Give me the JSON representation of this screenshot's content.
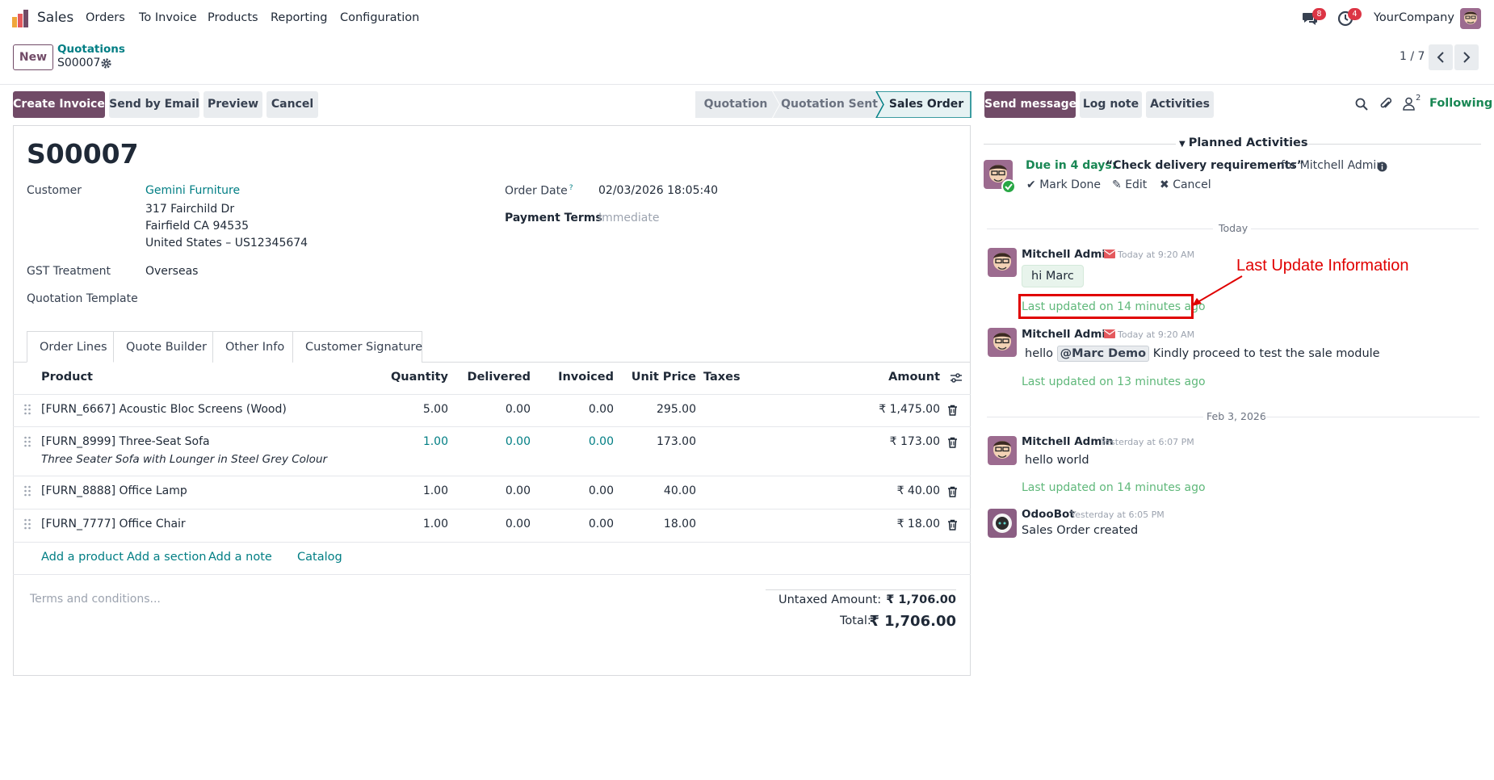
{
  "navbar": {
    "app_name": "Sales",
    "menu": [
      "Orders",
      "To Invoice",
      "Products",
      "Reporting",
      "Configuration"
    ],
    "chat_count": "8",
    "activity_count": "4",
    "company": "YourCompany"
  },
  "control_panel": {
    "new_label": "New",
    "breadcrumb_parent": "Quotations",
    "record_name": "S00007",
    "pager": "1 / 7"
  },
  "actions": {
    "create_invoice": "Create Invoice",
    "send_by_email": "Send by Email",
    "preview": "Preview",
    "cancel": "Cancel"
  },
  "statusbar": {
    "steps": [
      "Quotation",
      "Quotation Sent",
      "Sales Order"
    ],
    "active": "Sales Order"
  },
  "form": {
    "title": "S00007",
    "customer_label": "Customer",
    "customer_name": "Gemini Furniture",
    "customer_address": [
      "317 Fairchild Dr",
      "Fairfield CA 94535",
      "United States – US12345674"
    ],
    "gst_label": "GST Treatment",
    "gst_value": "Overseas",
    "template_label": "Quotation Template",
    "order_date_label": "Order Date",
    "order_date_help": "?",
    "order_date_value": "02/03/2026 18:05:40",
    "payment_terms_label": "Payment Terms",
    "payment_terms_value": "Immediate"
  },
  "tabs": [
    "Order Lines",
    "Quote Builder",
    "Other Info",
    "Customer Signature"
  ],
  "table": {
    "headers": {
      "product": "Product",
      "quantity": "Quantity",
      "delivered": "Delivered",
      "invoiced": "Invoiced",
      "unit_price": "Unit Price",
      "taxes": "Taxes",
      "amount": "Amount"
    },
    "rows": [
      {
        "product": "[FURN_6667] Acoustic Bloc Screens (Wood)",
        "description": "",
        "quantity": "5.00",
        "delivered": "0.00",
        "invoiced": "0.00",
        "unit_price": "295.00",
        "amount": "₹ 1,475.00"
      },
      {
        "product": "[FURN_8999] Three-Seat Sofa",
        "description": "Three Seater Sofa with Lounger in Steel Grey Colour",
        "quantity": "1.00",
        "delivered": "0.00",
        "invoiced": "0.00",
        "unit_price": "173.00",
        "amount": "₹ 173.00"
      },
      {
        "product": "[FURN_8888] Office Lamp",
        "description": "",
        "quantity": "1.00",
        "delivered": "0.00",
        "invoiced": "0.00",
        "unit_price": "40.00",
        "amount": "₹ 40.00"
      },
      {
        "product": "[FURN_7777] Office Chair",
        "description": "",
        "quantity": "1.00",
        "delivered": "0.00",
        "invoiced": "0.00",
        "unit_price": "18.00",
        "amount": "₹ 18.00"
      }
    ],
    "add_links": [
      "Add a product",
      "Add a section",
      "Add a note",
      "Catalog"
    ]
  },
  "totals": {
    "terms_placeholder": "Terms and conditions...",
    "untaxed_label": "Untaxed Amount:",
    "untaxed_value": "₹ 1,706.00",
    "total_label": "Total:",
    "total_value": "₹ 1,706.00"
  },
  "chatter": {
    "send_message": "Send message",
    "log_note": "Log note",
    "activities": "Activities",
    "followers_count": "2",
    "following": "Following",
    "planned_title": "Planned Activities",
    "activity": {
      "due": "Due in 4 days:",
      "summary": "“Check delivery requirements”",
      "for": "for Mitchell Admin",
      "mark_done": "Mark Done",
      "edit": "Edit",
      "cancel": "Cancel"
    },
    "separators": [
      "Today",
      "Feb 3, 2026"
    ],
    "messages": [
      {
        "author": "Mitchell Admin",
        "time": "Today at 9:20 AM",
        "body": "hi Marc",
        "tracking": "Last updated on 14 minutes ago"
      },
      {
        "author": "Mitchell Admin",
        "time": "Today at 9:20 AM",
        "body_pre": "hello",
        "mention": "@Marc Demo",
        "body_post": "Kindly proceed to test the sale module",
        "tracking": "Last updated on 13 minutes ago"
      },
      {
        "author": "Mitchell Admin",
        "time": "Yesterday at 6:07 PM",
        "body": "hello world",
        "tracking": "Last updated on 14 minutes ago"
      },
      {
        "author": "OdooBot",
        "time": "Yesterday at 6:05 PM",
        "body": "Sales Order created"
      }
    ]
  },
  "annotation": {
    "label": "Last Update Information",
    "color": "#e00000"
  },
  "colors": {
    "primary": "#714b67",
    "link": "#017e84",
    "success": "#198754",
    "tracking": "#5fb87a"
  }
}
